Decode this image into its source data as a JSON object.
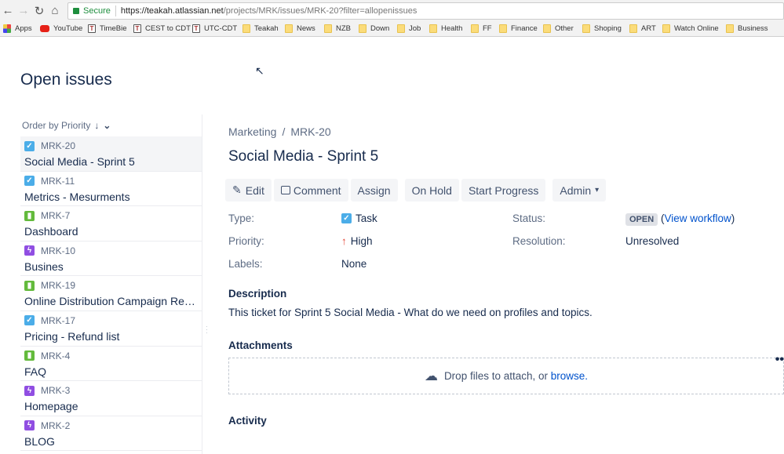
{
  "browser": {
    "secure": "Secure",
    "url_host": "https://teakah.atlassian.net",
    "url_path": "/projects/MRK/issues/MRK-20?filter=allopenissues",
    "bookmarks": [
      {
        "label": "Apps",
        "icon": "apps"
      },
      {
        "label": "YouTube",
        "icon": "yt"
      },
      {
        "label": "TimeBie",
        "icon": "tb"
      },
      {
        "label": "CEST to CDT",
        "icon": "tb"
      },
      {
        "label": "UTC-CDT",
        "icon": "tb"
      },
      {
        "label": "Teakah",
        "icon": "folder"
      },
      {
        "label": "News",
        "icon": "folder"
      },
      {
        "label": "NZB",
        "icon": "folder"
      },
      {
        "label": "Down",
        "icon": "folder"
      },
      {
        "label": "Job",
        "icon": "folder"
      },
      {
        "label": "Health",
        "icon": "folder"
      },
      {
        "label": "FF",
        "icon": "folder"
      },
      {
        "label": "Finance",
        "icon": "folder"
      },
      {
        "label": "Other",
        "icon": "folder"
      },
      {
        "label": "Shoping",
        "icon": "folder"
      },
      {
        "label": "ART",
        "icon": "folder"
      },
      {
        "label": "Watch Online",
        "icon": "folder"
      },
      {
        "label": "Business",
        "icon": "folder"
      }
    ]
  },
  "page_title": "Open issues",
  "sidebar": {
    "order_label": "Order by Priority",
    "items": [
      {
        "key": "MRK-20",
        "summary": "Social Media - Sprint 5",
        "type": "task",
        "selected": true
      },
      {
        "key": "MRK-11",
        "summary": "Metrics - Mesurments",
        "type": "task"
      },
      {
        "key": "MRK-7",
        "summary": "Dashboard",
        "type": "story"
      },
      {
        "key": "MRK-10",
        "summary": "Busines",
        "type": "epic"
      },
      {
        "key": "MRK-19",
        "summary": "Online Distribution Campaign Requirements",
        "type": "story"
      },
      {
        "key": "MRK-17",
        "summary": "Pricing - Refund list",
        "type": "task"
      },
      {
        "key": "MRK-4",
        "summary": "FAQ",
        "type": "story"
      },
      {
        "key": "MRK-3",
        "summary": "Homepage",
        "type": "epic"
      },
      {
        "key": "MRK-2",
        "summary": "BLOG",
        "type": "epic"
      }
    ]
  },
  "issue": {
    "breadcrumb": [
      "Marketing",
      "/",
      "MRK-20"
    ],
    "title": "Social Media - Sprint 5",
    "buttons": {
      "edit": "Edit",
      "comment": "Comment",
      "assign": "Assign",
      "hold": "On Hold",
      "progress": "Start Progress",
      "admin": "Admin"
    },
    "fields": {
      "type_label": "Type:",
      "type": "Task",
      "priority_label": "Priority:",
      "priority": "High",
      "labels_label": "Labels:",
      "labels": "None",
      "status_label": "Status:",
      "status": "OPEN",
      "workflow": "View workflow",
      "resolution_label": "Resolution:",
      "resolution": "Unresolved"
    },
    "description_title": "Description",
    "description": "This ticket for Sprint 5 Social Media - What do we need on profiles and topics.",
    "attachments_title": "Attachments",
    "drop_text": "Drop files to attach, or ",
    "browse": "browse.",
    "activity_title": "Activity"
  },
  "colors": {
    "task": "#4bade8",
    "story": "#63ba3c",
    "epic": "#904ee2",
    "priority_high": "#e5493a",
    "link": "#0052cc"
  }
}
